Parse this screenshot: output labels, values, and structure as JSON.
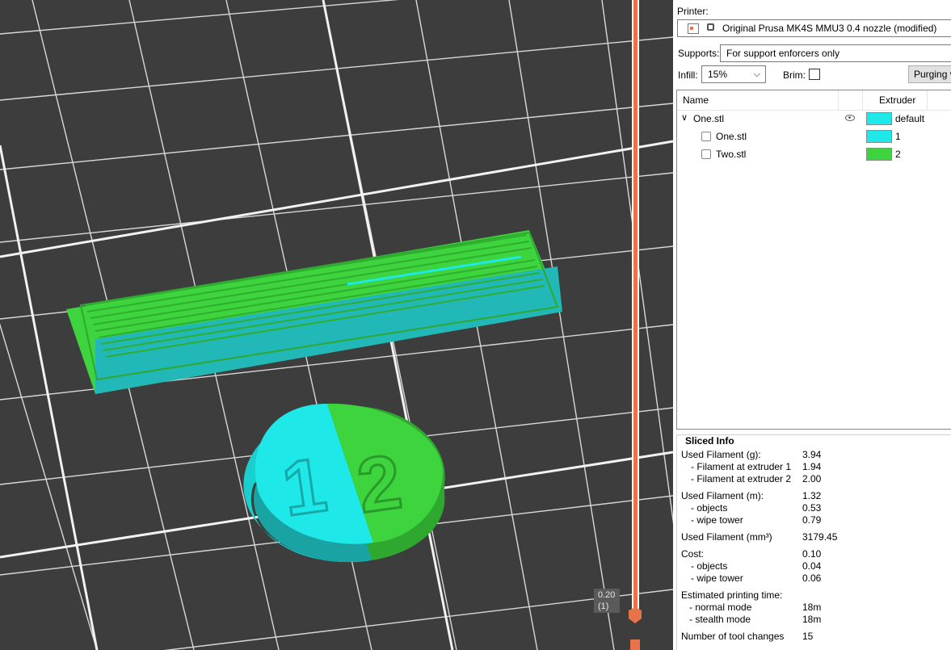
{
  "viewport": {
    "layer_value": "0.20",
    "layer_index": "(1)",
    "colors": {
      "background": "#3d3d3d",
      "grid": "#e0e0e0",
      "extruder1": "#1ee8e8",
      "extruder2": "#3ed43e",
      "slider": "#e8734a"
    }
  },
  "printer": {
    "label": "Printer:",
    "value": "Original Prusa MK4S MMU3 0.4 nozzle (modified)"
  },
  "supports": {
    "label": "Supports:",
    "value": "For support enforcers only"
  },
  "infill": {
    "label": "Infill:",
    "value": "15%"
  },
  "brim": {
    "label": "Brim:",
    "checked": false
  },
  "purging_button": "Purging v",
  "object_list": {
    "headers": {
      "name": "Name",
      "extruder": "Extruder"
    },
    "rows": [
      {
        "name": "One.stl",
        "extruder": "default",
        "color": "#1ee8e8"
      },
      {
        "name": "One.stl",
        "extruder": "1",
        "color": "#1ee8e8"
      },
      {
        "name": "Two.stl",
        "extruder": "2",
        "color": "#3ed43e"
      }
    ]
  },
  "sliced_info": {
    "title": "Sliced Info",
    "rows": [
      {
        "key": "Used Filament (g):",
        "value": "3.94"
      },
      {
        "key": "  - Filament at extruder 1",
        "value": "1.94"
      },
      {
        "key": "  - Filament at extruder 2",
        "value": "2.00"
      },
      {
        "key": "Used Filament (m):",
        "value": "1.32"
      },
      {
        "key": "  - objects",
        "value": "0.53"
      },
      {
        "key": "  - wipe tower",
        "value": "0.79"
      },
      {
        "key": "Used Filament (mm³)",
        "value": "3179.45"
      },
      {
        "key": "Cost:",
        "value": "0.10"
      },
      {
        "key": "  - objects",
        "value": "0.04"
      },
      {
        "key": "  - wipe tower",
        "value": "0.06"
      },
      {
        "key": "Estimated printing time:",
        "value": ""
      },
      {
        "key": "  - normal mode",
        "value": "18m"
      },
      {
        "key": "  - stealth mode",
        "value": "18m"
      },
      {
        "key": "Number of tool changes",
        "value": "15"
      }
    ]
  }
}
